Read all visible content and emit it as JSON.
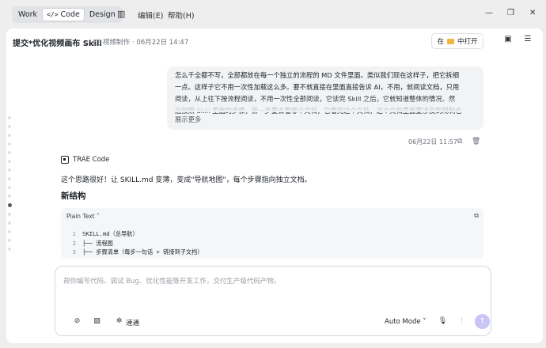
{
  "titlebar": {
    "modes": [
      {
        "label": "Work",
        "active": false
      },
      {
        "label": "Code",
        "active": true,
        "icon": "</>"
      },
      {
        "label": "Design",
        "active": false
      }
    ],
    "menus": [
      "编辑(E)",
      "帮助(H)"
    ]
  },
  "header": {
    "title": "提交*优化视频画布 Skill",
    "crumb_folder": "视频制作",
    "crumb_date": "· 06月22日 14:47",
    "open_in_prefix": "在",
    "open_in_label": "中打开"
  },
  "user_message": {
    "lines": [
      "怎么千全都不写，全部都放在每一个独立的流程的 MD 文件里面。类似我们现在这样子，把它拆细",
      "一点。这样子它不用一次性加载这么多。要不就直接在里面直接告诉 AI，不用，就阅读文档，只用",
      "阅读，从上往下按流程阅读，不用一次性全部阅读，它读完 Skill 之后，它就知道整体的情况。然",
      "后按照 Skill 里面的步骤，第一步要去看哪个文档，它看完这个文档，这个文档里面要涉及到规制也"
    ],
    "show_more": "展示更多",
    "time": "06月22日 11:57"
  },
  "ai": {
    "name": "TRAE Code",
    "text": "这个思路很好！让 SKILL.md 变薄，变成\"导航地图\"，每个步骤指向独立文档。",
    "heading": "新结构",
    "code_lang": "Plain Text",
    "code_lines": [
      {
        "n": "1",
        "t": "SKILL.md（总导航）"
      },
      {
        "n": "2",
        "t": "├── 流程图"
      },
      {
        "n": "3",
        "t": "├── 步骤清单（每步一句话 + 链接到子文档）"
      }
    ]
  },
  "input": {
    "placeholder": "帮你编写代码、调试 Bug、优化性能等开发工作，交付生产级代码产物。",
    "tool_label": "速通",
    "mode_label": "Auto Mode"
  },
  "icons": {
    "sidebar_toggle": "panel-icon",
    "folder": "folder-icon",
    "copy": "copy-icon",
    "delete": "trash-icon",
    "send": "arrow-up-icon",
    "accent": "#c9c5f5"
  }
}
